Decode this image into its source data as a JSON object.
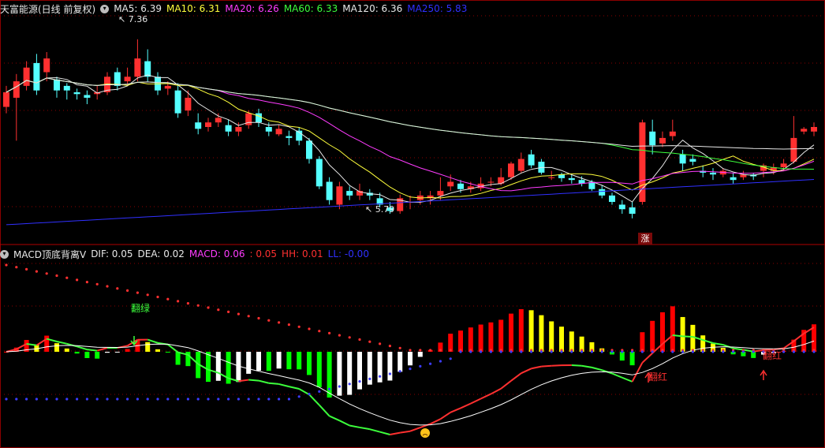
{
  "top_panel": {
    "stock_title": "天富能源(日线 前复权)",
    "ma": [
      {
        "label": "MA5: 6.39",
        "color": "#e8e8e8"
      },
      {
        "label": "MA10: 6.31",
        "color": "#ffff3c"
      },
      {
        "label": "MA20: 6.26",
        "color": "#ff3cff"
      },
      {
        "label": "MA60: 6.33",
        "color": "#3cff3c"
      },
      {
        "label": "MA120: 6.36",
        "color": "#e8e8e8"
      },
      {
        "label": "MA250: 5.83",
        "color": "#3030ff"
      }
    ],
    "high_label": "7.36",
    "low_label": "5.79",
    "badge": "涨"
  },
  "bottom_panel": {
    "indicator_title": "MACD顶底背离V",
    "values": [
      {
        "label": "DIF: 0.05",
        "color": "#e8e8e8"
      },
      {
        "label": "DEA: 0.02",
        "color": "#e8e8e8"
      },
      {
        "label": "MACD: 0.06",
        "color": "#ff3cff"
      },
      {
        "label": ": 0.05",
        "color": "#ff3030"
      },
      {
        "label": "HH: 0.01",
        "color": "#ff3030"
      },
      {
        "label": "LL: -0.00",
        "color": "#3030ff"
      }
    ],
    "annot_green": "翻绿",
    "annot_red1": "翻红",
    "annot_red2": "翻红"
  },
  "colors": {
    "up": "#ff3030",
    "down": "#54ffff",
    "macd_up": "#ff0000",
    "macd_fade": "#ffff00",
    "macd_down": "#00ff00",
    "macd_neg_fade": "#ffffff",
    "grid": "#8b0000"
  },
  "chart_data": {
    "type": "candlestick",
    "ylim_price": [
      5.2,
      7.6
    ],
    "candles": [
      [
        6.62,
        6.78,
        6.55,
        6.85
      ],
      [
        6.72,
        6.9,
        6.25,
        6.98
      ],
      [
        6.85,
        7.05,
        6.8,
        7.12
      ],
      [
        7.1,
        6.8,
        6.75,
        7.2
      ],
      [
        7.0,
        7.15,
        6.9,
        7.22
      ],
      [
        6.92,
        6.8,
        6.72,
        6.95
      ],
      [
        6.85,
        6.8,
        6.7,
        6.88
      ],
      [
        6.78,
        6.76,
        6.7,
        6.82
      ],
      [
        6.75,
        6.72,
        6.65,
        6.8
      ],
      [
        6.76,
        6.78,
        6.7,
        6.85
      ],
      [
        6.78,
        6.95,
        6.75,
        7.0
      ],
      [
        7.0,
        6.85,
        6.8,
        7.05
      ],
      [
        6.9,
        6.95,
        6.85,
        7.05
      ],
      [
        6.95,
        7.15,
        6.9,
        7.36
      ],
      [
        7.12,
        6.95,
        6.9,
        7.25
      ],
      [
        6.95,
        6.8,
        6.75,
        7.0
      ],
      [
        6.82,
        6.85,
        6.75,
        6.9
      ],
      [
        6.8,
        6.55,
        6.5,
        6.88
      ],
      [
        6.58,
        6.72,
        6.52,
        6.8
      ],
      [
        6.45,
        6.38,
        6.32,
        6.55
      ],
      [
        6.4,
        6.45,
        6.35,
        6.5
      ],
      [
        6.45,
        6.5,
        6.4,
        6.55
      ],
      [
        6.42,
        6.35,
        6.3,
        6.48
      ],
      [
        6.35,
        6.4,
        6.3,
        6.45
      ],
      [
        6.42,
        6.55,
        6.38,
        6.58
      ],
      [
        6.55,
        6.45,
        6.4,
        6.6
      ],
      [
        6.4,
        6.35,
        6.3,
        6.45
      ],
      [
        6.32,
        6.38,
        6.3,
        6.42
      ],
      [
        6.3,
        6.28,
        6.2,
        6.36
      ],
      [
        6.36,
        6.25,
        6.2,
        6.4
      ],
      [
        6.25,
        6.05,
        6.0,
        6.28
      ],
      [
        6.05,
        5.75,
        5.72,
        6.08
      ],
      [
        5.8,
        5.6,
        5.55,
        5.85
      ],
      [
        5.55,
        5.75,
        5.5,
        5.8
      ],
      [
        5.7,
        5.65,
        5.6,
        5.75
      ],
      [
        5.65,
        5.7,
        5.6,
        5.78
      ],
      [
        5.68,
        5.65,
        5.6,
        5.72
      ],
      [
        5.62,
        5.55,
        5.52,
        5.68
      ],
      [
        5.52,
        5.48,
        5.45,
        5.58
      ],
      [
        5.48,
        5.62,
        5.45,
        5.66
      ],
      [
        5.58,
        5.58,
        5.5,
        5.65
      ],
      [
        5.6,
        5.65,
        5.55,
        5.7
      ],
      [
        5.62,
        5.65,
        5.55,
        5.7
      ],
      [
        5.65,
        5.7,
        5.6,
        5.85
      ],
      [
        5.75,
        5.8,
        5.7,
        5.88
      ],
      [
        5.78,
        5.72,
        5.68,
        5.82
      ],
      [
        5.72,
        5.75,
        5.68,
        5.8
      ],
      [
        5.73,
        5.78,
        5.7,
        5.85
      ],
      [
        5.8,
        5.8,
        5.75,
        5.85
      ],
      [
        5.78,
        5.85,
        5.76,
        5.95
      ],
      [
        5.85,
        6.0,
        5.82,
        6.02
      ],
      [
        5.92,
        6.05,
        5.9,
        6.12
      ],
      [
        6.1,
        5.98,
        5.95,
        6.15
      ],
      [
        6.02,
        5.9,
        5.88,
        6.05
      ],
      [
        5.85,
        5.85,
        5.82,
        5.92
      ],
      [
        5.88,
        5.84,
        5.8,
        5.9
      ],
      [
        5.84,
        5.82,
        5.78,
        5.88
      ],
      [
        5.82,
        5.78,
        5.75,
        5.86
      ],
      [
        5.8,
        5.72,
        5.7,
        5.82
      ],
      [
        5.72,
        5.65,
        5.62,
        5.76
      ],
      [
        5.65,
        5.58,
        5.55,
        5.68
      ],
      [
        5.55,
        5.5,
        5.45,
        5.6
      ],
      [
        5.52,
        5.45,
        5.4,
        5.58
      ],
      [
        5.58,
        6.45,
        5.55,
        6.48
      ],
      [
        6.35,
        6.2,
        6.1,
        6.48
      ],
      [
        6.22,
        6.28,
        6.18,
        6.35
      ],
      [
        6.3,
        6.35,
        6.25,
        6.48
      ],
      [
        6.1,
        6.0,
        5.92,
        6.15
      ],
      [
        6.05,
        6.02,
        5.98,
        6.1
      ],
      [
        5.92,
        5.9,
        5.85,
        5.98
      ],
      [
        5.9,
        5.88,
        5.82,
        5.95
      ],
      [
        5.88,
        5.92,
        5.85,
        5.95
      ],
      [
        5.85,
        5.82,
        5.78,
        5.9
      ],
      [
        5.85,
        5.88,
        5.82,
        5.92
      ],
      [
        5.88,
        5.86,
        5.82,
        5.9
      ],
      [
        5.92,
        5.98,
        5.85,
        6.0
      ],
      [
        5.92,
        5.96,
        5.88,
        6.0
      ],
      [
        5.96,
        6.0,
        5.92,
        6.05
      ],
      [
        6.02,
        6.28,
        6.0,
        6.52
      ],
      [
        6.35,
        6.38,
        6.32,
        6.4
      ],
      [
        6.35,
        6.4,
        6.3,
        6.45
      ]
    ]
  }
}
